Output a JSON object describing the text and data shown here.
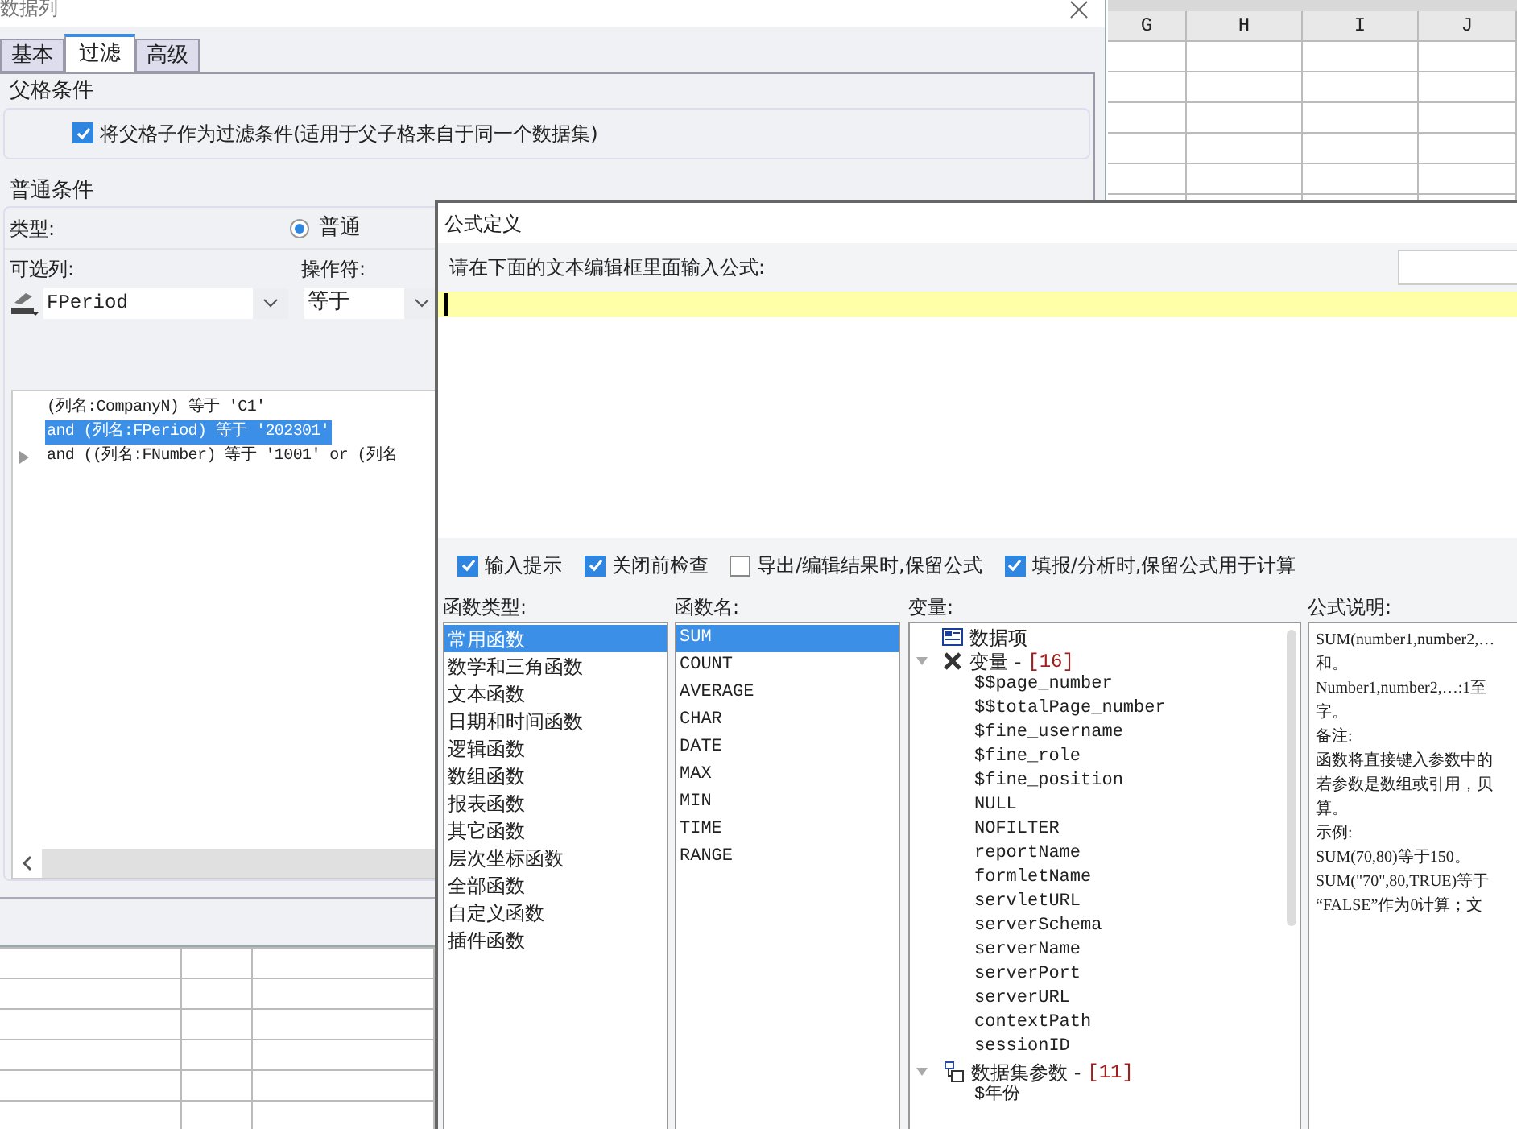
{
  "sheet": {
    "columns": [
      "G",
      "H",
      "I",
      "J"
    ]
  },
  "column_dialog": {
    "title": "数据列",
    "tabs": [
      {
        "label": "基本",
        "selected": false
      },
      {
        "label": "过滤",
        "selected": true
      },
      {
        "label": "高级",
        "selected": false
      }
    ],
    "parent_section": {
      "title": "父格条件",
      "checkbox": {
        "label": "将父格子作为过滤条件(适用于父子格来自于同一个数据集)",
        "checked": true
      }
    },
    "normal_section": {
      "title": "普通条件",
      "type_label": "类型:",
      "type_radio": {
        "label": "普通",
        "selected": true
      },
      "column_label": "可选列:",
      "column_value": "FPeriod",
      "operator_label": "操作符:",
      "operator_value": "等于",
      "conditions": [
        {
          "text": "(列名:CompanyN) 等于 'C1'",
          "selected": false,
          "expandable": false
        },
        {
          "text": "and (列名:FPeriod) 等于 '202301'",
          "selected": true,
          "expandable": false
        },
        {
          "text": "and ((列名:FNumber) 等于 '1001' or (列名",
          "selected": false,
          "expandable": true
        }
      ]
    }
  },
  "formula_dialog": {
    "title": "公式定义",
    "prompt": "请在下面的文本编辑框里面输入公式:",
    "options": [
      {
        "label": "输入提示",
        "checked": true
      },
      {
        "label": "关闭前检查",
        "checked": true
      },
      {
        "label": "导出/编辑结果时,保留公式",
        "checked": false
      },
      {
        "label": "填报/分析时,保留公式用于计算",
        "checked": true
      }
    ],
    "function_types": {
      "label": "函数类型:",
      "items": [
        {
          "label": "常用函数",
          "selected": true
        },
        {
          "label": "数学和三角函数",
          "selected": false
        },
        {
          "label": "文本函数",
          "selected": false
        },
        {
          "label": "日期和时间函数",
          "selected": false
        },
        {
          "label": "逻辑函数",
          "selected": false
        },
        {
          "label": "数组函数",
          "selected": false
        },
        {
          "label": "报表函数",
          "selected": false
        },
        {
          "label": "其它函数",
          "selected": false
        },
        {
          "label": "层次坐标函数",
          "selected": false
        },
        {
          "label": "全部函数",
          "selected": false
        },
        {
          "label": "自定义函数",
          "selected": false
        },
        {
          "label": "插件函数",
          "selected": false
        }
      ]
    },
    "function_names": {
      "label": "函数名:",
      "items": [
        {
          "label": "SUM",
          "selected": true
        },
        {
          "label": "COUNT",
          "selected": false
        },
        {
          "label": "AVERAGE",
          "selected": false
        },
        {
          "label": "CHAR",
          "selected": false
        },
        {
          "label": "DATE",
          "selected": false
        },
        {
          "label": "MAX",
          "selected": false
        },
        {
          "label": "MIN",
          "selected": false
        },
        {
          "label": "TIME",
          "selected": false
        },
        {
          "label": "RANGE",
          "selected": false
        }
      ]
    },
    "variables": {
      "label": "变量:",
      "items": [
        {
          "kind": "item",
          "label": "数据项"
        },
        {
          "kind": "variables",
          "label": "变量 -",
          "count": "[16]",
          "expanded": true,
          "children": [
            {
              "label": "$$page_number"
            },
            {
              "label": "$$totalPage_number"
            },
            {
              "label": "$fine_username"
            },
            {
              "label": "$fine_role"
            },
            {
              "label": "$fine_position"
            },
            {
              "label": "NULL"
            },
            {
              "label": "NOFILTER"
            },
            {
              "label": "reportName"
            },
            {
              "label": "formletName"
            },
            {
              "label": "servletURL"
            },
            {
              "label": "serverSchema"
            },
            {
              "label": "serverName"
            },
            {
              "label": "serverPort"
            },
            {
              "label": "serverURL"
            },
            {
              "label": "contextPath"
            },
            {
              "label": "sessionID"
            }
          ]
        },
        {
          "kind": "parameters",
          "label": "数据集参数 -",
          "count": "[11]",
          "expanded": true,
          "children": [
            {
              "label": "$年份"
            }
          ]
        }
      ]
    },
    "description": {
      "label": "公式说明:",
      "lines": [
        "SUM(number1,number2,…",
        "和。",
        "Number1,number2,…:1至",
        "字。",
        "备注:",
        "函数将直接键入参数中的",
        "若参数是数组或引用，贝",
        "算。",
        "示例:",
        "SUM(70,80)等于150。",
        "SUM(\"70\",80,TRUE)等于",
        "“FALSE”作为0计算；文"
      ]
    }
  }
}
